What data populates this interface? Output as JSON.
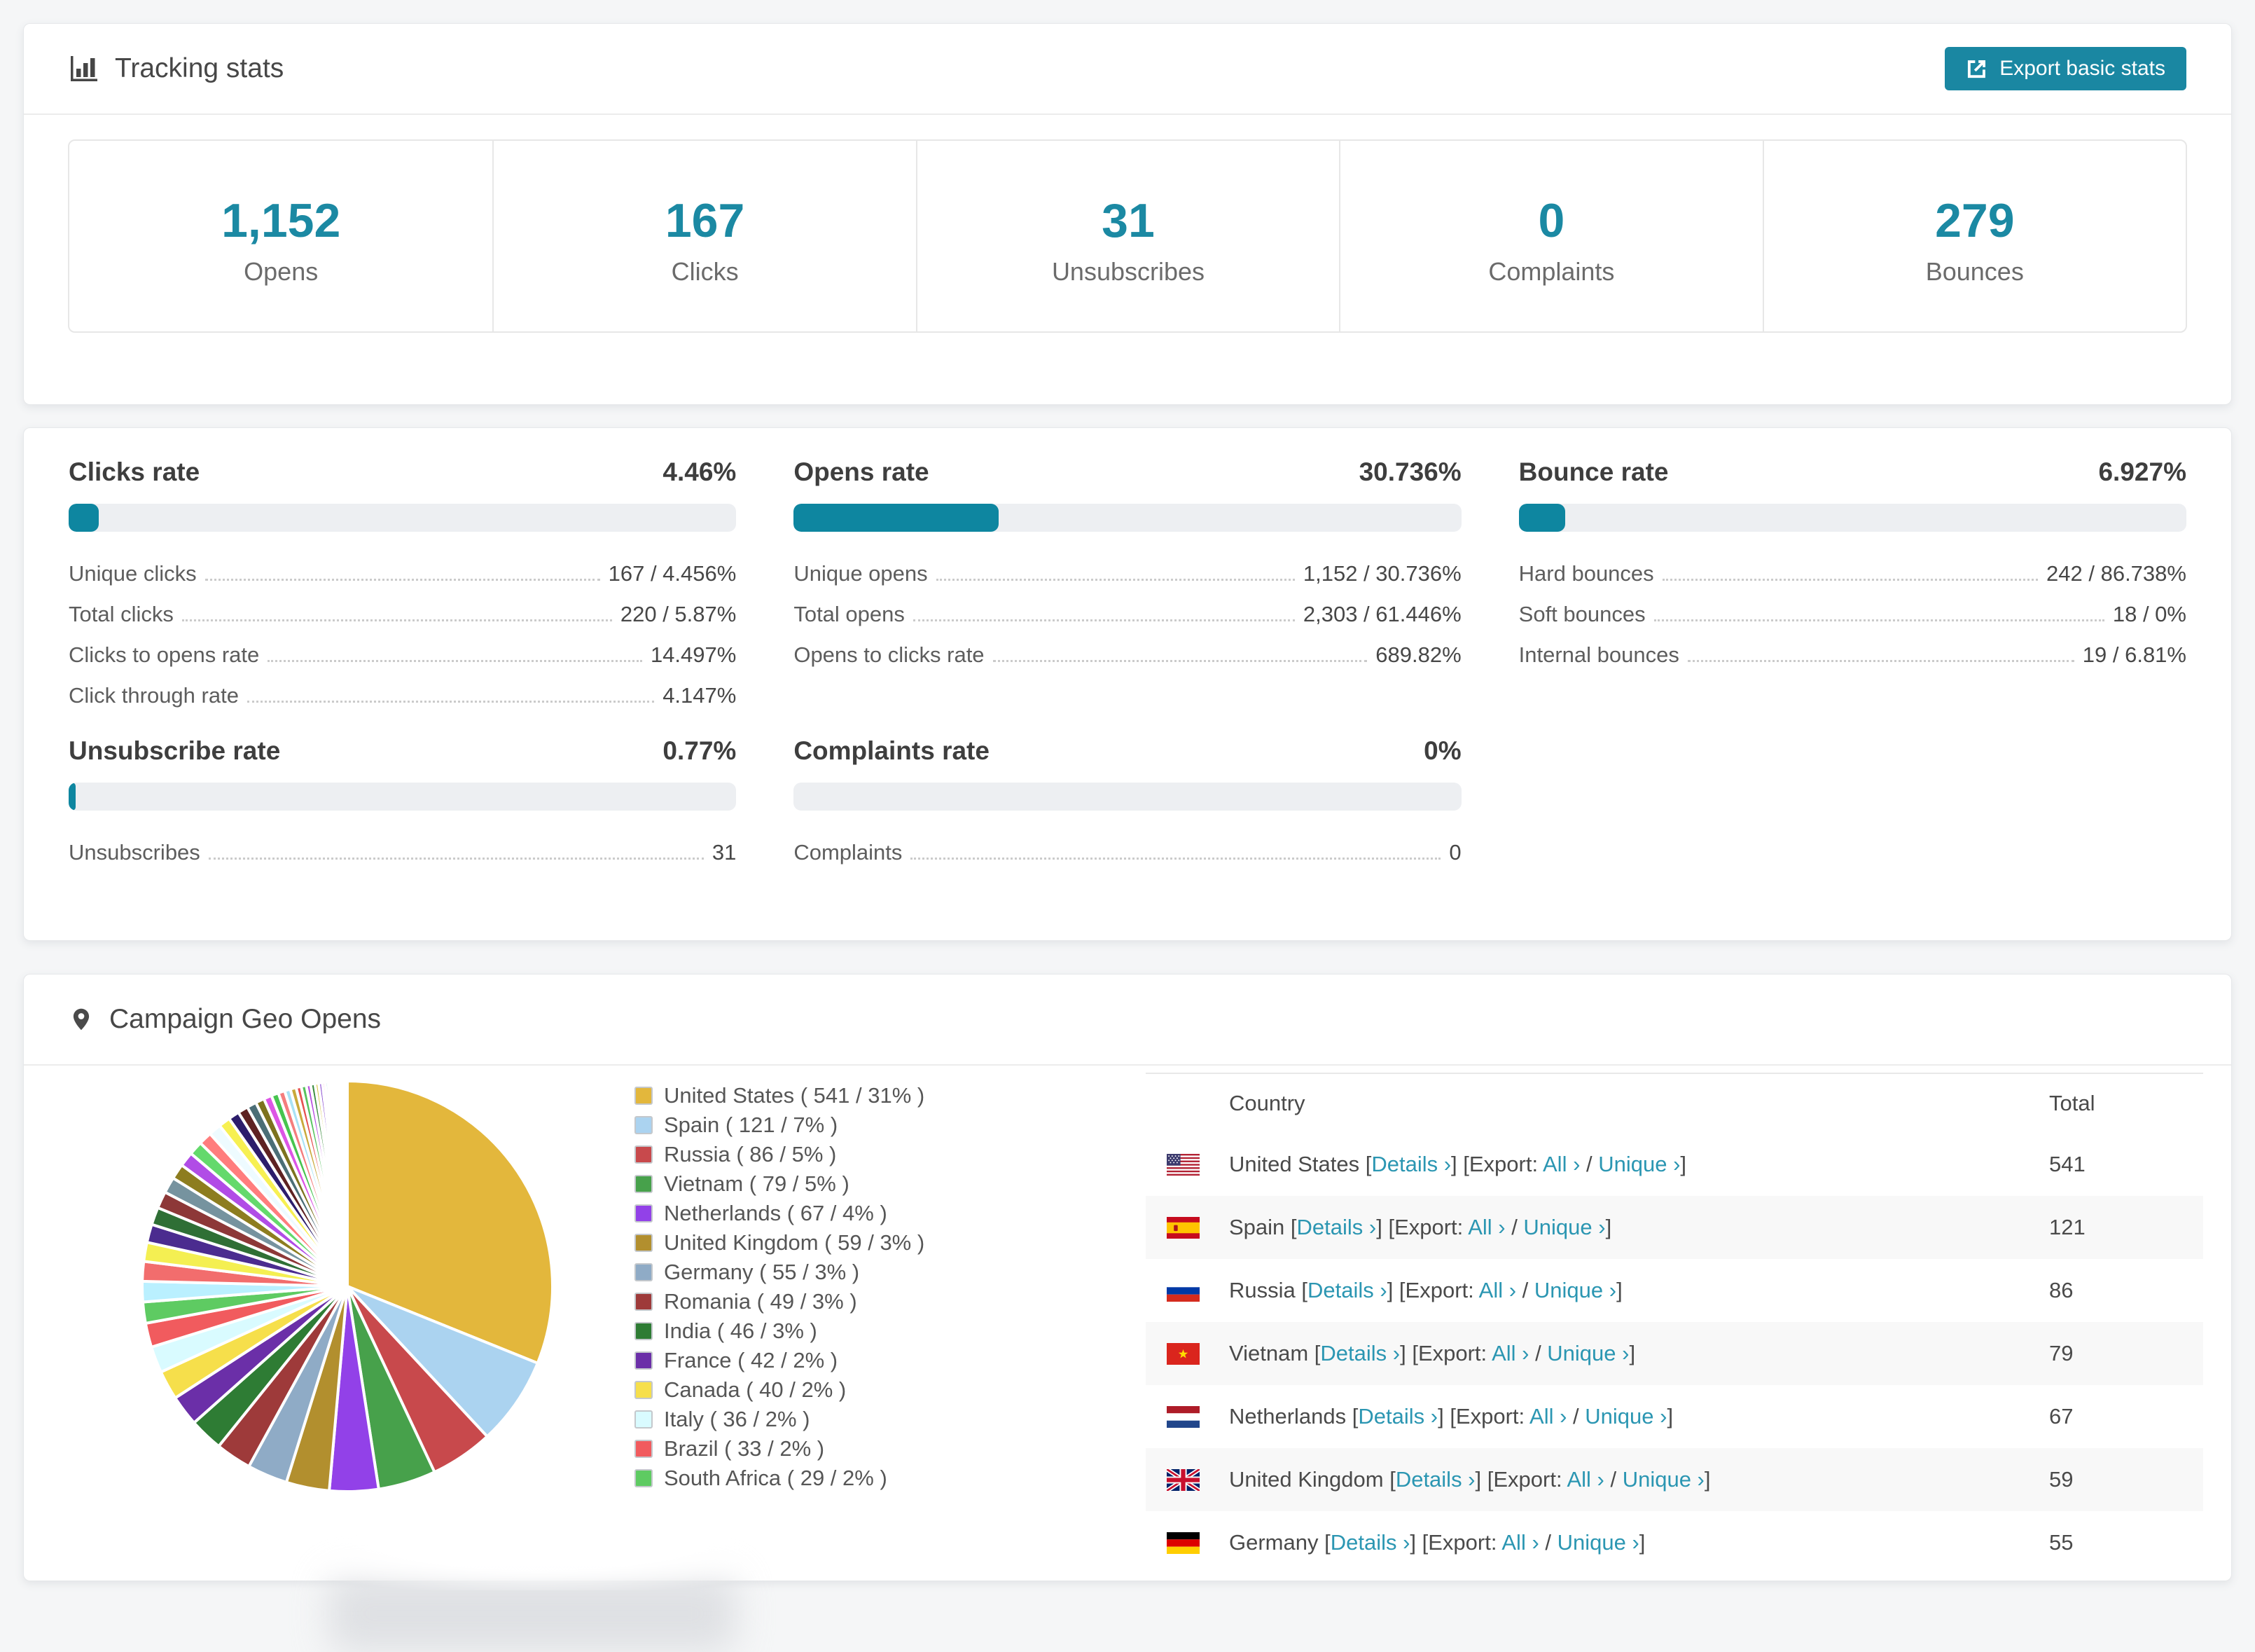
{
  "accent": "#1a87a2",
  "tracking": {
    "title": "Tracking stats",
    "export_button": "Export basic stats",
    "stats": [
      {
        "value": "1,152",
        "label": "Opens"
      },
      {
        "value": "167",
        "label": "Clicks"
      },
      {
        "value": "31",
        "label": "Unsubscribes"
      },
      {
        "value": "0",
        "label": "Complaints"
      },
      {
        "value": "279",
        "label": "Bounces"
      }
    ]
  },
  "rates": {
    "clicks": {
      "title": "Clicks rate",
      "value": "4.46%",
      "pct": 4.46,
      "rows": [
        {
          "label": "Unique clicks",
          "value": "167 / 4.456%"
        },
        {
          "label": "Total clicks",
          "value": "220 / 5.87%"
        },
        {
          "label": "Clicks to opens rate",
          "value": "14.497%"
        },
        {
          "label": "Click through rate",
          "value": "4.147%"
        }
      ]
    },
    "opens": {
      "title": "Opens rate",
      "value": "30.736%",
      "pct": 30.736,
      "rows": [
        {
          "label": "Unique opens",
          "value": "1,152 / 30.736%"
        },
        {
          "label": "Total opens",
          "value": "2,303 / 61.446%"
        },
        {
          "label": "Opens to clicks rate",
          "value": "689.82%"
        }
      ]
    },
    "bounce": {
      "title": "Bounce rate",
      "value": "6.927%",
      "pct": 6.927,
      "rows": [
        {
          "label": "Hard bounces",
          "value": "242 / 86.738%"
        },
        {
          "label": "Soft bounces",
          "value": "18 / 0%"
        },
        {
          "label": "Internal bounces",
          "value": "19 / 6.81%"
        }
      ]
    },
    "unsubscribe": {
      "title": "Unsubscribe rate",
      "value": "0.77%",
      "pct": 0.77,
      "rows": [
        {
          "label": "Unsubscribes",
          "value": "31"
        }
      ]
    },
    "complaints": {
      "title": "Complaints rate",
      "value": "0%",
      "pct": 0,
      "rows": [
        {
          "label": "Complaints",
          "value": "0"
        }
      ]
    }
  },
  "geo": {
    "title": "Campaign Geo Opens",
    "legend": [
      {
        "label": "United States ( 541 / 31% )",
        "color": "#e3b73c"
      },
      {
        "label": "Spain ( 121 / 7% )",
        "color": "#abd3f0"
      },
      {
        "label": "Russia ( 86 / 5% )",
        "color": "#c8494c"
      },
      {
        "label": "Vietnam ( 79 / 5% )",
        "color": "#47a14b"
      },
      {
        "label": "Netherlands ( 67 / 4% )",
        "color": "#9241e8"
      },
      {
        "label": "United Kingdom ( 59 / 3% )",
        "color": "#b28f2e"
      },
      {
        "label": "Germany ( 55 / 3% )",
        "color": "#8fabc6"
      },
      {
        "label": "Romania ( 49 / 3% )",
        "color": "#9e3a3a"
      },
      {
        "label": "India ( 46 / 3% )",
        "color": "#2e7c34"
      },
      {
        "label": "France ( 42 / 2% )",
        "color": "#6b2fa8"
      },
      {
        "label": "Canada ( 40 / 2% )",
        "color": "#f6df4b"
      },
      {
        "label": "Italy ( 36 / 2% )",
        "color": "#d9fbff"
      },
      {
        "label": "Brazil ( 33 / 2% )",
        "color": "#f15b5e"
      },
      {
        "label": "South Africa ( 29 / 2% )",
        "color": "#5ecb62"
      }
    ],
    "table": {
      "columns": {
        "country": "Country",
        "total": "Total"
      },
      "frag": {
        "f1": " [",
        "details": "Details ›",
        "f2": "] [Export: ",
        "all": "All ›",
        "f3": " / ",
        "unique": "Unique ›",
        "f4": "]"
      },
      "rows": [
        {
          "flag": "us",
          "country": "United States",
          "total": "541"
        },
        {
          "flag": "es",
          "country": "Spain",
          "total": "121"
        },
        {
          "flag": "ru",
          "country": "Russia",
          "total": "86"
        },
        {
          "flag": "vn",
          "country": "Vietnam",
          "total": "79"
        },
        {
          "flag": "nl",
          "country": "Netherlands",
          "total": "67"
        },
        {
          "flag": "gb",
          "country": "United Kingdom",
          "total": "59"
        },
        {
          "flag": "de",
          "country": "Germany",
          "total": "55"
        }
      ]
    }
  },
  "chart_data": {
    "type": "pie",
    "title": "Campaign Geo Opens",
    "legend_position": "right",
    "start_angle_deg": 0,
    "slices": [
      {
        "label": "United States",
        "value": 541,
        "color": "#e3b73c"
      },
      {
        "label": "Spain",
        "value": 121,
        "color": "#abd3f0"
      },
      {
        "label": "Russia",
        "value": 86,
        "color": "#c8494c"
      },
      {
        "label": "Vietnam",
        "value": 79,
        "color": "#47a14b"
      },
      {
        "label": "Netherlands",
        "value": 67,
        "color": "#9241e8"
      },
      {
        "label": "United Kingdom",
        "value": 59,
        "color": "#b28f2e"
      },
      {
        "label": "Germany",
        "value": 55,
        "color": "#8fabc6"
      },
      {
        "label": "Romania",
        "value": 49,
        "color": "#9e3a3a"
      },
      {
        "label": "India",
        "value": 46,
        "color": "#2e7c34"
      },
      {
        "label": "France",
        "value": 42,
        "color": "#6b2fa8"
      },
      {
        "label": "Canada",
        "value": 40,
        "color": "#f6df4b"
      },
      {
        "label": "Italy",
        "value": 36,
        "color": "#d9fbff"
      },
      {
        "label": "Brazil",
        "value": 33,
        "color": "#f15b5e"
      },
      {
        "label": "South Africa",
        "value": 29,
        "color": "#5ecb62"
      }
    ],
    "others_tail": {
      "note": "long tail of small unlabeled countries, values estimated from slice angles",
      "values": [
        28,
        27,
        26,
        25,
        24,
        23,
        22,
        21,
        20,
        19,
        18,
        17,
        16,
        15,
        14,
        13,
        12,
        11,
        10,
        9,
        8,
        8,
        7,
        7,
        6,
        6,
        5,
        5,
        4,
        4,
        3,
        3,
        3,
        2,
        2,
        2,
        2,
        1,
        1,
        1,
        1,
        1,
        1,
        1,
        1,
        1
      ],
      "colors": [
        "#baf0ff",
        "#f26d6d",
        "#f4ef52",
        "#4b2c8f",
        "#2f6f35",
        "#8d3838",
        "#76939f",
        "#8d7d1f",
        "#b14ce6",
        "#64d96c",
        "#ff7d7d",
        "#eefbff",
        "#f7f052",
        "#2c1d6b",
        "#5e2222",
        "#4b6e76",
        "#7d721f",
        "#dc55e5",
        "#47c44f",
        "#f47d7d",
        "#a9e2f5",
        "#c9a93b",
        "#e65252",
        "#57c35f",
        "#b852e2",
        "#3d8d41",
        "#d6c43d",
        "#8d52d2",
        "#ea6f9e",
        "#52cbc2",
        "#9e3d5e",
        "#d2ea52",
        "#526de6",
        "#eaa952",
        "#6dea52",
        "#ea52d2",
        "#3b6b9e",
        "#d23b3b",
        "#52eaa9",
        "#6b3b9e",
        "#ead252",
        "#3b9e6b",
        "#e67373",
        "#737be6",
        "#9e9e3b",
        "#e652a9"
      ]
    }
  }
}
